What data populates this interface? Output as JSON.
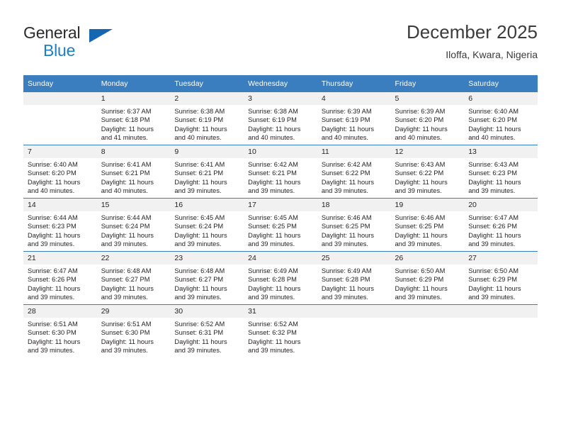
{
  "brand": {
    "line1": "General",
    "line2": "Blue",
    "triangle_color": "#1567b1",
    "blue_text_color": "#1d7fc3"
  },
  "header": {
    "title": "December 2025",
    "subtitle": "Iloffa, Kwara, Nigeria"
  },
  "theme": {
    "header_row_bg": "#3a7ebf",
    "daynum_bg": "#f1f1f1",
    "cell_bg": "#ffffff",
    "text_color": "#231f20"
  },
  "weekday_headers": [
    "Sunday",
    "Monday",
    "Tuesday",
    "Wednesday",
    "Thursday",
    "Friday",
    "Saturday"
  ],
  "labels": {
    "sunrise_prefix": "Sunrise:",
    "sunset_prefix": "Sunset:",
    "daylight_prefix": "Daylight:"
  },
  "weeks": [
    {
      "days": [
        {
          "date": "",
          "sunrise": "",
          "sunset": "",
          "daylight_line1": "",
          "daylight_line2": "",
          "empty": true
        },
        {
          "date": "1",
          "sunrise": "Sunrise: 6:37 AM",
          "sunset": "Sunset: 6:18 PM",
          "daylight_line1": "Daylight: 11 hours",
          "daylight_line2": "and 41 minutes.",
          "empty": false
        },
        {
          "date": "2",
          "sunrise": "Sunrise: 6:38 AM",
          "sunset": "Sunset: 6:19 PM",
          "daylight_line1": "Daylight: 11 hours",
          "daylight_line2": "and 40 minutes.",
          "empty": false
        },
        {
          "date": "3",
          "sunrise": "Sunrise: 6:38 AM",
          "sunset": "Sunset: 6:19 PM",
          "daylight_line1": "Daylight: 11 hours",
          "daylight_line2": "and 40 minutes.",
          "empty": false
        },
        {
          "date": "4",
          "sunrise": "Sunrise: 6:39 AM",
          "sunset": "Sunset: 6:19 PM",
          "daylight_line1": "Daylight: 11 hours",
          "daylight_line2": "and 40 minutes.",
          "empty": false
        },
        {
          "date": "5",
          "sunrise": "Sunrise: 6:39 AM",
          "sunset": "Sunset: 6:20 PM",
          "daylight_line1": "Daylight: 11 hours",
          "daylight_line2": "and 40 minutes.",
          "empty": false
        },
        {
          "date": "6",
          "sunrise": "Sunrise: 6:40 AM",
          "sunset": "Sunset: 6:20 PM",
          "daylight_line1": "Daylight: 11 hours",
          "daylight_line2": "and 40 minutes.",
          "empty": false
        }
      ]
    },
    {
      "days": [
        {
          "date": "7",
          "sunrise": "Sunrise: 6:40 AM",
          "sunset": "Sunset: 6:20 PM",
          "daylight_line1": "Daylight: 11 hours",
          "daylight_line2": "and 40 minutes.",
          "empty": false
        },
        {
          "date": "8",
          "sunrise": "Sunrise: 6:41 AM",
          "sunset": "Sunset: 6:21 PM",
          "daylight_line1": "Daylight: 11 hours",
          "daylight_line2": "and 40 minutes.",
          "empty": false
        },
        {
          "date": "9",
          "sunrise": "Sunrise: 6:41 AM",
          "sunset": "Sunset: 6:21 PM",
          "daylight_line1": "Daylight: 11 hours",
          "daylight_line2": "and 39 minutes.",
          "empty": false
        },
        {
          "date": "10",
          "sunrise": "Sunrise: 6:42 AM",
          "sunset": "Sunset: 6:21 PM",
          "daylight_line1": "Daylight: 11 hours",
          "daylight_line2": "and 39 minutes.",
          "empty": false
        },
        {
          "date": "11",
          "sunrise": "Sunrise: 6:42 AM",
          "sunset": "Sunset: 6:22 PM",
          "daylight_line1": "Daylight: 11 hours",
          "daylight_line2": "and 39 minutes.",
          "empty": false
        },
        {
          "date": "12",
          "sunrise": "Sunrise: 6:43 AM",
          "sunset": "Sunset: 6:22 PM",
          "daylight_line1": "Daylight: 11 hours",
          "daylight_line2": "and 39 minutes.",
          "empty": false
        },
        {
          "date": "13",
          "sunrise": "Sunrise: 6:43 AM",
          "sunset": "Sunset: 6:23 PM",
          "daylight_line1": "Daylight: 11 hours",
          "daylight_line2": "and 39 minutes.",
          "empty": false
        }
      ]
    },
    {
      "days": [
        {
          "date": "14",
          "sunrise": "Sunrise: 6:44 AM",
          "sunset": "Sunset: 6:23 PM",
          "daylight_line1": "Daylight: 11 hours",
          "daylight_line2": "and 39 minutes.",
          "empty": false
        },
        {
          "date": "15",
          "sunrise": "Sunrise: 6:44 AM",
          "sunset": "Sunset: 6:24 PM",
          "daylight_line1": "Daylight: 11 hours",
          "daylight_line2": "and 39 minutes.",
          "empty": false
        },
        {
          "date": "16",
          "sunrise": "Sunrise: 6:45 AM",
          "sunset": "Sunset: 6:24 PM",
          "daylight_line1": "Daylight: 11 hours",
          "daylight_line2": "and 39 minutes.",
          "empty": false
        },
        {
          "date": "17",
          "sunrise": "Sunrise: 6:45 AM",
          "sunset": "Sunset: 6:25 PM",
          "daylight_line1": "Daylight: 11 hours",
          "daylight_line2": "and 39 minutes.",
          "empty": false
        },
        {
          "date": "18",
          "sunrise": "Sunrise: 6:46 AM",
          "sunset": "Sunset: 6:25 PM",
          "daylight_line1": "Daylight: 11 hours",
          "daylight_line2": "and 39 minutes.",
          "empty": false
        },
        {
          "date": "19",
          "sunrise": "Sunrise: 6:46 AM",
          "sunset": "Sunset: 6:25 PM",
          "daylight_line1": "Daylight: 11 hours",
          "daylight_line2": "and 39 minutes.",
          "empty": false
        },
        {
          "date": "20",
          "sunrise": "Sunrise: 6:47 AM",
          "sunset": "Sunset: 6:26 PM",
          "daylight_line1": "Daylight: 11 hours",
          "daylight_line2": "and 39 minutes.",
          "empty": false
        }
      ]
    },
    {
      "days": [
        {
          "date": "21",
          "sunrise": "Sunrise: 6:47 AM",
          "sunset": "Sunset: 6:26 PM",
          "daylight_line1": "Daylight: 11 hours",
          "daylight_line2": "and 39 minutes.",
          "empty": false
        },
        {
          "date": "22",
          "sunrise": "Sunrise: 6:48 AM",
          "sunset": "Sunset: 6:27 PM",
          "daylight_line1": "Daylight: 11 hours",
          "daylight_line2": "and 39 minutes.",
          "empty": false
        },
        {
          "date": "23",
          "sunrise": "Sunrise: 6:48 AM",
          "sunset": "Sunset: 6:27 PM",
          "daylight_line1": "Daylight: 11 hours",
          "daylight_line2": "and 39 minutes.",
          "empty": false
        },
        {
          "date": "24",
          "sunrise": "Sunrise: 6:49 AM",
          "sunset": "Sunset: 6:28 PM",
          "daylight_line1": "Daylight: 11 hours",
          "daylight_line2": "and 39 minutes.",
          "empty": false
        },
        {
          "date": "25",
          "sunrise": "Sunrise: 6:49 AM",
          "sunset": "Sunset: 6:28 PM",
          "daylight_line1": "Daylight: 11 hours",
          "daylight_line2": "and 39 minutes.",
          "empty": false
        },
        {
          "date": "26",
          "sunrise": "Sunrise: 6:50 AM",
          "sunset": "Sunset: 6:29 PM",
          "daylight_line1": "Daylight: 11 hours",
          "daylight_line2": "and 39 minutes.",
          "empty": false
        },
        {
          "date": "27",
          "sunrise": "Sunrise: 6:50 AM",
          "sunset": "Sunset: 6:29 PM",
          "daylight_line1": "Daylight: 11 hours",
          "daylight_line2": "and 39 minutes.",
          "empty": false
        }
      ]
    },
    {
      "days": [
        {
          "date": "28",
          "sunrise": "Sunrise: 6:51 AM",
          "sunset": "Sunset: 6:30 PM",
          "daylight_line1": "Daylight: 11 hours",
          "daylight_line2": "and 39 minutes.",
          "empty": false
        },
        {
          "date": "29",
          "sunrise": "Sunrise: 6:51 AM",
          "sunset": "Sunset: 6:30 PM",
          "daylight_line1": "Daylight: 11 hours",
          "daylight_line2": "and 39 minutes.",
          "empty": false
        },
        {
          "date": "30",
          "sunrise": "Sunrise: 6:52 AM",
          "sunset": "Sunset: 6:31 PM",
          "daylight_line1": "Daylight: 11 hours",
          "daylight_line2": "and 39 minutes.",
          "empty": false
        },
        {
          "date": "31",
          "sunrise": "Sunrise: 6:52 AM",
          "sunset": "Sunset: 6:32 PM",
          "daylight_line1": "Daylight: 11 hours",
          "daylight_line2": "and 39 minutes.",
          "empty": false
        },
        {
          "date": "",
          "sunrise": "",
          "sunset": "",
          "daylight_line1": "",
          "daylight_line2": "",
          "empty": true
        },
        {
          "date": "",
          "sunrise": "",
          "sunset": "",
          "daylight_line1": "",
          "daylight_line2": "",
          "empty": true
        },
        {
          "date": "",
          "sunrise": "",
          "sunset": "",
          "daylight_line1": "",
          "daylight_line2": "",
          "empty": true
        }
      ]
    }
  ]
}
